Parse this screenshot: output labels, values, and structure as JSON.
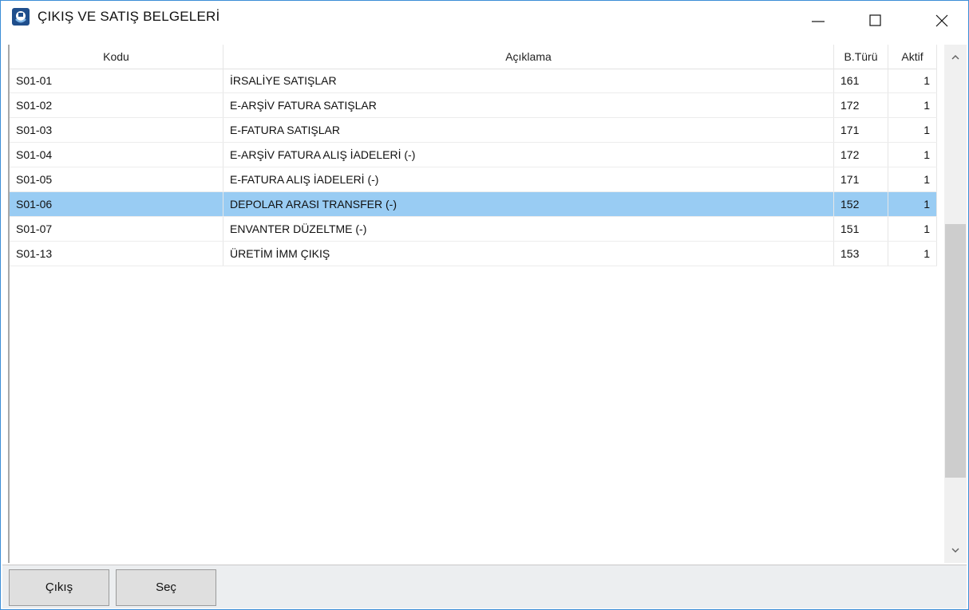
{
  "window": {
    "title": "ÇIKIŞ VE SATIŞ BELGELERİ",
    "app_icon": "app-logo-icon",
    "controls": [
      "minimize-icon",
      "maximize-icon",
      "close-icon"
    ]
  },
  "table": {
    "columns": [
      "Kodu",
      "Açıklama",
      "B.Türü",
      "Aktif"
    ],
    "selected_index": 5,
    "rows": [
      {
        "kodu": "S01-01",
        "aciklama": "İRSALİYE SATIŞLAR",
        "btur": "161",
        "aktif": "1"
      },
      {
        "kodu": "S01-02",
        "aciklama": "E-ARŞİV FATURA SATIŞLAR",
        "btur": "172",
        "aktif": "1"
      },
      {
        "kodu": "S01-03",
        "aciklama": "E-FATURA SATIŞLAR",
        "btur": "171",
        "aktif": "1"
      },
      {
        "kodu": "S01-04",
        "aciklama": "E-ARŞİV FATURA ALIŞ İADELERİ (-)",
        "btur": "172",
        "aktif": "1"
      },
      {
        "kodu": "S01-05",
        "aciklama": "E-FATURA ALIŞ İADELERİ (-)",
        "btur": "171",
        "aktif": "1"
      },
      {
        "kodu": "S01-06",
        "aciklama": "DEPOLAR ARASI TRANSFER (-)",
        "btur": "152",
        "aktif": "1"
      },
      {
        "kodu": "S01-07",
        "aciklama": "ENVANTER DÜZELTME (-)",
        "btur": "151",
        "aktif": "1"
      },
      {
        "kodu": "S01-13",
        "aciklama": "ÜRETİM İMM ÇIKIŞ",
        "btur": "153",
        "aktif": "1"
      }
    ]
  },
  "toolbar": {
    "exit_label": "Çıkış",
    "select_label": "Seç"
  },
  "colors": {
    "selection": "#99ccf3",
    "window_border": "#3c8dd6"
  }
}
